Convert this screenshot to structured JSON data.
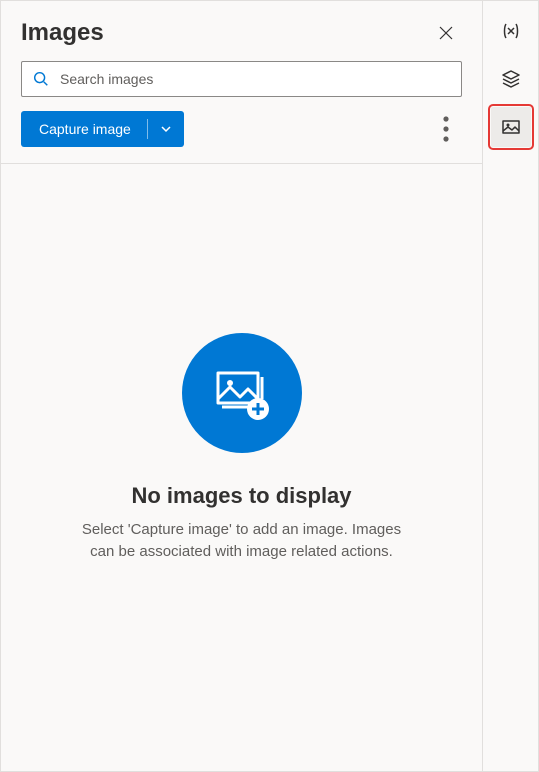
{
  "header": {
    "title": "Images"
  },
  "search": {
    "placeholder": "Search images"
  },
  "toolbar": {
    "capture_label": "Capture image"
  },
  "empty": {
    "title": "No images to display",
    "description": "Select 'Capture image' to add an image. Images can be associated with image related actions."
  },
  "sidebar": {
    "items": [
      {
        "name": "variables",
        "selected": false
      },
      {
        "name": "ui-elements",
        "selected": false
      },
      {
        "name": "images",
        "selected": true
      }
    ]
  }
}
